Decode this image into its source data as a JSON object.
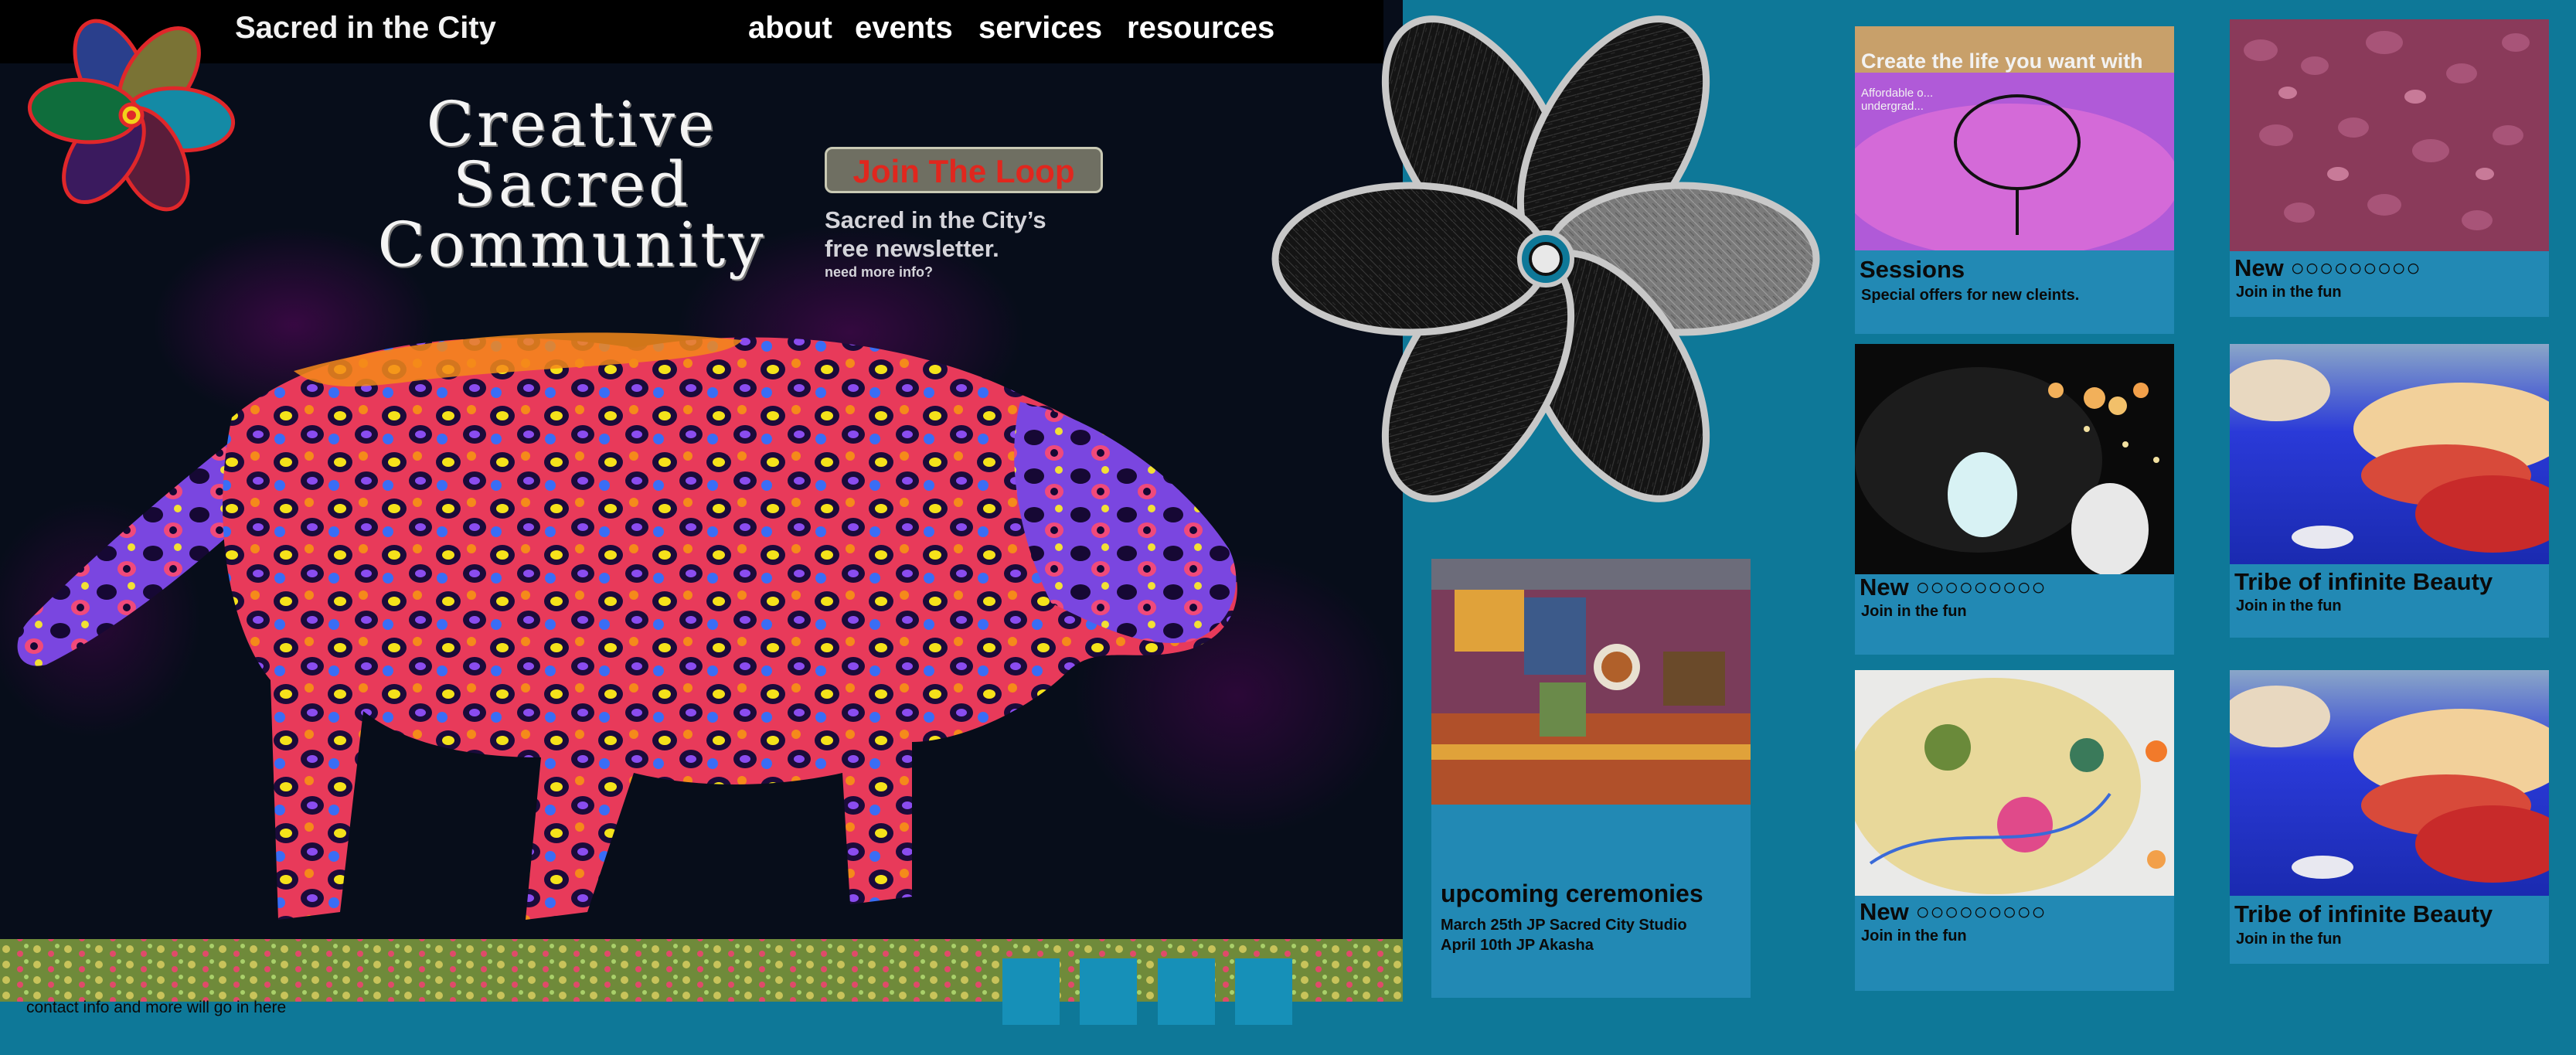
{
  "header": {
    "brand": "Sacred in the City",
    "nav": [
      "about",
      "events",
      "services",
      "resources"
    ]
  },
  "hero": {
    "headline": [
      "Creative",
      "Sacred",
      "Community"
    ],
    "cta_label": "Join The Loop",
    "newsletter_line1": "Sacred in the City’s",
    "newsletter_line2": "free newsletter.",
    "more_info": "need more info?"
  },
  "footer": {
    "contact": "contact info and more will go in here"
  },
  "ceremonies": {
    "title": "upcoming ceremonies",
    "dates": [
      "March 25th JP Sacred City Studio",
      "April 10th JP Akasha"
    ]
  },
  "cards": [
    {
      "title": "Sessions",
      "subtitle": "Special offers for new cleints.",
      "banner": "Create the life you want with",
      "banner_sub": "Affordable o... undergrad..."
    },
    {
      "title": "New ○○○○○○○○○",
      "subtitle": "Join in the fun"
    },
    {
      "title": "New ○○○○○○○○○",
      "subtitle": "Join in the fun"
    },
    {
      "title": "New ○○○○○○○○○",
      "subtitle": "Join in the fun"
    },
    {
      "title": "Tribe of infinite Beauty",
      "subtitle": "Join in the fun"
    },
    {
      "title": "Tribe of infinite Beauty",
      "subtitle": "Join in the fun"
    }
  ],
  "colors": {
    "page_bg": "#0e7898",
    "card_bg": "#2289b4",
    "cta_text": "#e0271e"
  }
}
